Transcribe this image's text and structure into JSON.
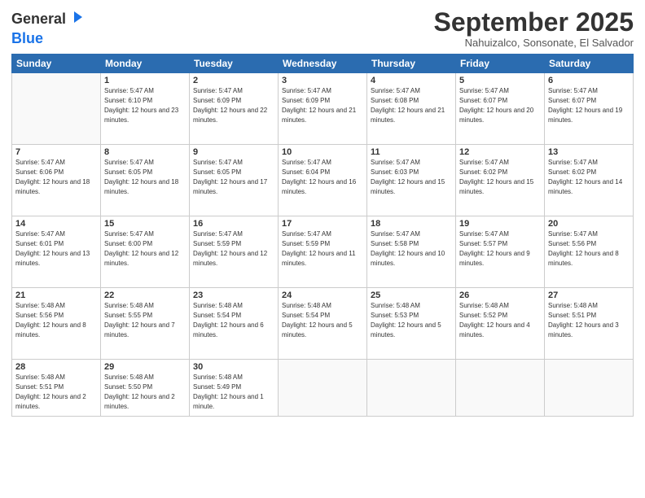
{
  "logo": {
    "general": "General",
    "blue": "Blue"
  },
  "title": "September 2025",
  "subtitle": "Nahuizalco, Sonsonate, El Salvador",
  "days": [
    "Sunday",
    "Monday",
    "Tuesday",
    "Wednesday",
    "Thursday",
    "Friday",
    "Saturday"
  ],
  "weeks": [
    [
      {
        "date": "",
        "sunrise": "",
        "sunset": "",
        "daylight": ""
      },
      {
        "date": "1",
        "sunrise": "Sunrise: 5:47 AM",
        "sunset": "Sunset: 6:10 PM",
        "daylight": "Daylight: 12 hours and 23 minutes."
      },
      {
        "date": "2",
        "sunrise": "Sunrise: 5:47 AM",
        "sunset": "Sunset: 6:09 PM",
        "daylight": "Daylight: 12 hours and 22 minutes."
      },
      {
        "date": "3",
        "sunrise": "Sunrise: 5:47 AM",
        "sunset": "Sunset: 6:09 PM",
        "daylight": "Daylight: 12 hours and 21 minutes."
      },
      {
        "date": "4",
        "sunrise": "Sunrise: 5:47 AM",
        "sunset": "Sunset: 6:08 PM",
        "daylight": "Daylight: 12 hours and 21 minutes."
      },
      {
        "date": "5",
        "sunrise": "Sunrise: 5:47 AM",
        "sunset": "Sunset: 6:07 PM",
        "daylight": "Daylight: 12 hours and 20 minutes."
      },
      {
        "date": "6",
        "sunrise": "Sunrise: 5:47 AM",
        "sunset": "Sunset: 6:07 PM",
        "daylight": "Daylight: 12 hours and 19 minutes."
      }
    ],
    [
      {
        "date": "7",
        "sunrise": "Sunrise: 5:47 AM",
        "sunset": "Sunset: 6:06 PM",
        "daylight": "Daylight: 12 hours and 18 minutes."
      },
      {
        "date": "8",
        "sunrise": "Sunrise: 5:47 AM",
        "sunset": "Sunset: 6:05 PM",
        "daylight": "Daylight: 12 hours and 18 minutes."
      },
      {
        "date": "9",
        "sunrise": "Sunrise: 5:47 AM",
        "sunset": "Sunset: 6:05 PM",
        "daylight": "Daylight: 12 hours and 17 minutes."
      },
      {
        "date": "10",
        "sunrise": "Sunrise: 5:47 AM",
        "sunset": "Sunset: 6:04 PM",
        "daylight": "Daylight: 12 hours and 16 minutes."
      },
      {
        "date": "11",
        "sunrise": "Sunrise: 5:47 AM",
        "sunset": "Sunset: 6:03 PM",
        "daylight": "Daylight: 12 hours and 15 minutes."
      },
      {
        "date": "12",
        "sunrise": "Sunrise: 5:47 AM",
        "sunset": "Sunset: 6:02 PM",
        "daylight": "Daylight: 12 hours and 15 minutes."
      },
      {
        "date": "13",
        "sunrise": "Sunrise: 5:47 AM",
        "sunset": "Sunset: 6:02 PM",
        "daylight": "Daylight: 12 hours and 14 minutes."
      }
    ],
    [
      {
        "date": "14",
        "sunrise": "Sunrise: 5:47 AM",
        "sunset": "Sunset: 6:01 PM",
        "daylight": "Daylight: 12 hours and 13 minutes."
      },
      {
        "date": "15",
        "sunrise": "Sunrise: 5:47 AM",
        "sunset": "Sunset: 6:00 PM",
        "daylight": "Daylight: 12 hours and 12 minutes."
      },
      {
        "date": "16",
        "sunrise": "Sunrise: 5:47 AM",
        "sunset": "Sunset: 5:59 PM",
        "daylight": "Daylight: 12 hours and 12 minutes."
      },
      {
        "date": "17",
        "sunrise": "Sunrise: 5:47 AM",
        "sunset": "Sunset: 5:59 PM",
        "daylight": "Daylight: 12 hours and 11 minutes."
      },
      {
        "date": "18",
        "sunrise": "Sunrise: 5:47 AM",
        "sunset": "Sunset: 5:58 PM",
        "daylight": "Daylight: 12 hours and 10 minutes."
      },
      {
        "date": "19",
        "sunrise": "Sunrise: 5:47 AM",
        "sunset": "Sunset: 5:57 PM",
        "daylight": "Daylight: 12 hours and 9 minutes."
      },
      {
        "date": "20",
        "sunrise": "Sunrise: 5:47 AM",
        "sunset": "Sunset: 5:56 PM",
        "daylight": "Daylight: 12 hours and 8 minutes."
      }
    ],
    [
      {
        "date": "21",
        "sunrise": "Sunrise: 5:48 AM",
        "sunset": "Sunset: 5:56 PM",
        "daylight": "Daylight: 12 hours and 8 minutes."
      },
      {
        "date": "22",
        "sunrise": "Sunrise: 5:48 AM",
        "sunset": "Sunset: 5:55 PM",
        "daylight": "Daylight: 12 hours and 7 minutes."
      },
      {
        "date": "23",
        "sunrise": "Sunrise: 5:48 AM",
        "sunset": "Sunset: 5:54 PM",
        "daylight": "Daylight: 12 hours and 6 minutes."
      },
      {
        "date": "24",
        "sunrise": "Sunrise: 5:48 AM",
        "sunset": "Sunset: 5:54 PM",
        "daylight": "Daylight: 12 hours and 5 minutes."
      },
      {
        "date": "25",
        "sunrise": "Sunrise: 5:48 AM",
        "sunset": "Sunset: 5:53 PM",
        "daylight": "Daylight: 12 hours and 5 minutes."
      },
      {
        "date": "26",
        "sunrise": "Sunrise: 5:48 AM",
        "sunset": "Sunset: 5:52 PM",
        "daylight": "Daylight: 12 hours and 4 minutes."
      },
      {
        "date": "27",
        "sunrise": "Sunrise: 5:48 AM",
        "sunset": "Sunset: 5:51 PM",
        "daylight": "Daylight: 12 hours and 3 minutes."
      }
    ],
    [
      {
        "date": "28",
        "sunrise": "Sunrise: 5:48 AM",
        "sunset": "Sunset: 5:51 PM",
        "daylight": "Daylight: 12 hours and 2 minutes."
      },
      {
        "date": "29",
        "sunrise": "Sunrise: 5:48 AM",
        "sunset": "Sunset: 5:50 PM",
        "daylight": "Daylight: 12 hours and 2 minutes."
      },
      {
        "date": "30",
        "sunrise": "Sunrise: 5:48 AM",
        "sunset": "Sunset: 5:49 PM",
        "daylight": "Daylight: 12 hours and 1 minute."
      },
      {
        "date": "",
        "sunrise": "",
        "sunset": "",
        "daylight": ""
      },
      {
        "date": "",
        "sunrise": "",
        "sunset": "",
        "daylight": ""
      },
      {
        "date": "",
        "sunrise": "",
        "sunset": "",
        "daylight": ""
      },
      {
        "date": "",
        "sunrise": "",
        "sunset": "",
        "daylight": ""
      }
    ]
  ]
}
